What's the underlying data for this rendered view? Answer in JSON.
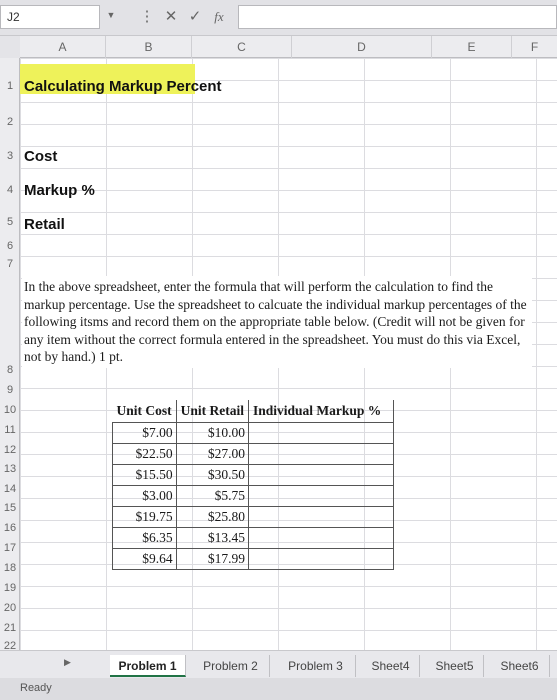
{
  "formula_bar": {
    "name_box": "J2",
    "cancel_icon": "✕",
    "enter_icon": "✓",
    "fx_icon": "fx",
    "formula": ""
  },
  "columns": [
    "A",
    "B",
    "C",
    "D",
    "E",
    "F"
  ],
  "rows": [
    "1",
    "2",
    "3",
    "4",
    "5",
    "6",
    "7",
    "8",
    "9",
    "10",
    "11",
    "12",
    "13",
    "14",
    "15",
    "16",
    "17",
    "18",
    "19",
    "20",
    "21",
    "22"
  ],
  "cells": {
    "title": "Calculating Markup Percent",
    "cost": "Cost",
    "markup": "Markup %",
    "retail": "Retail"
  },
  "instructions": "In the above spreadsheet, enter the formula that will perform the calculation to find the markup percentage. Use the spreadsheet to calcuate the individual markup percentages of the following itsms and record them on the appropriate table below. (Credit will not be given for any item without the correct formula entered in the spreadsheet. You must do this via Excel, not by hand.) 1 pt.",
  "markup_table": {
    "headers": [
      "Unit Cost",
      "Unit Retail",
      "Individual Markup %"
    ],
    "rows": [
      [
        "$7.00",
        "$10.00",
        ""
      ],
      [
        "$22.50",
        "$27.00",
        ""
      ],
      [
        "$15.50",
        "$30.50",
        ""
      ],
      [
        "$3.00",
        "$5.75",
        ""
      ],
      [
        "$19.75",
        "$25.80",
        ""
      ],
      [
        "$6.35",
        "$13.45",
        ""
      ],
      [
        "$9.64",
        "$17.99",
        ""
      ]
    ]
  },
  "sheet_tabs": [
    "Problem 1",
    "Problem 2",
    "Problem 3",
    "Sheet4",
    "Sheet5",
    "Sheet6"
  ],
  "active_tab": "Problem 1",
  "status": "Ready",
  "colors": {
    "title_highlight": "#eef25a",
    "accent": "#217346"
  }
}
